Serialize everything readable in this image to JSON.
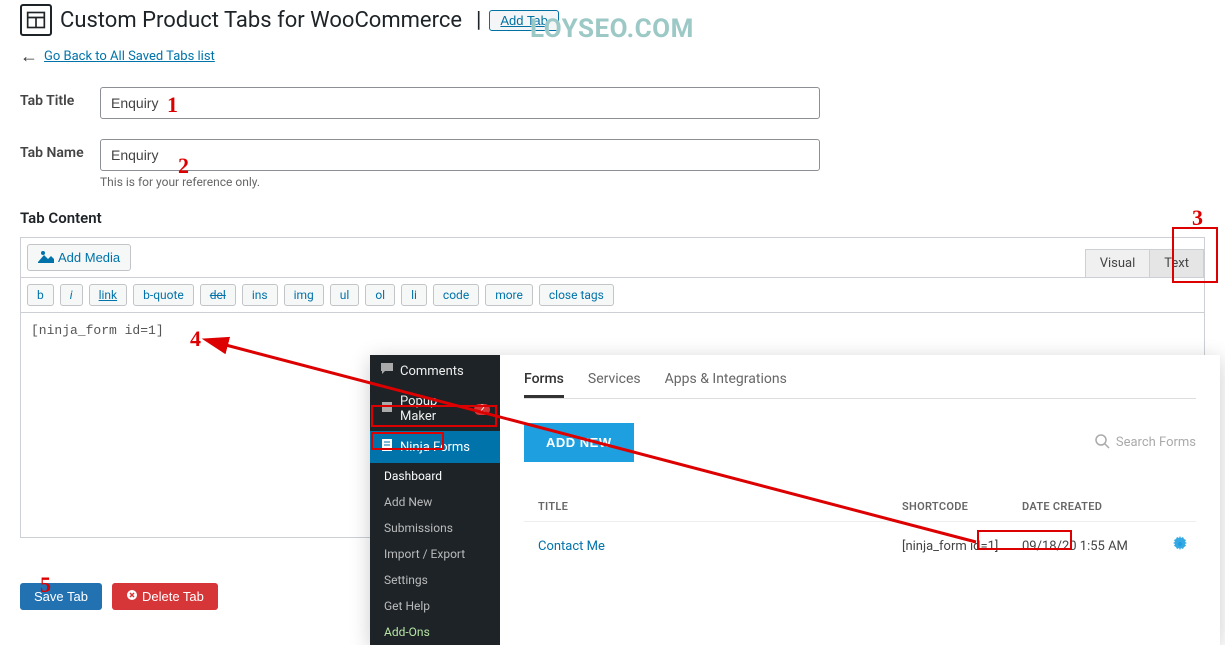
{
  "header": {
    "title": "Custom Product Tabs for WooCommerce",
    "add_tab": "Add Tab"
  },
  "back_link": "Go Back to All Saved Tabs list",
  "fields": {
    "title_label": "Tab Title",
    "title_value": "Enquiry",
    "name_label": "Tab Name",
    "name_value": "Enquiry",
    "name_hint": "This is for your reference only."
  },
  "content": {
    "label": "Tab Content",
    "add_media": "Add Media",
    "tabs": {
      "visual": "Visual",
      "text": "Text"
    },
    "quicktags": [
      "b",
      "i",
      "link",
      "b-quote",
      "del",
      "ins",
      "img",
      "ul",
      "ol",
      "li",
      "code",
      "more",
      "close tags"
    ],
    "textarea_value": "[ninja_form id=1]"
  },
  "actions": {
    "save": "Save Tab",
    "delete": "Delete Tab"
  },
  "annotations": {
    "n1": "1",
    "n2": "2",
    "n3": "3",
    "n4": "4",
    "n5": "5",
    "watermark": "LOYSEO.COM"
  },
  "overlay": {
    "side": {
      "comments": "Comments",
      "popup": "Popup Maker",
      "popup_badge": "2",
      "ninja": "Ninja Forms",
      "subs": [
        "Dashboard",
        "Add New",
        "Submissions",
        "Import / Export",
        "Settings",
        "Get Help",
        "Add-Ons"
      ]
    },
    "nf": {
      "tabs": [
        "Forms",
        "Services",
        "Apps & Integrations"
      ],
      "add_new": "ADD NEW",
      "search_placeholder": "Search Forms",
      "headers": {
        "title": "TITLE",
        "code": "SHORTCODE",
        "date": "DATE CREATED"
      },
      "row": {
        "title": "Contact Me",
        "code": "[ninja_form id=1]",
        "date": "09/18/20 1:55 AM"
      }
    }
  }
}
